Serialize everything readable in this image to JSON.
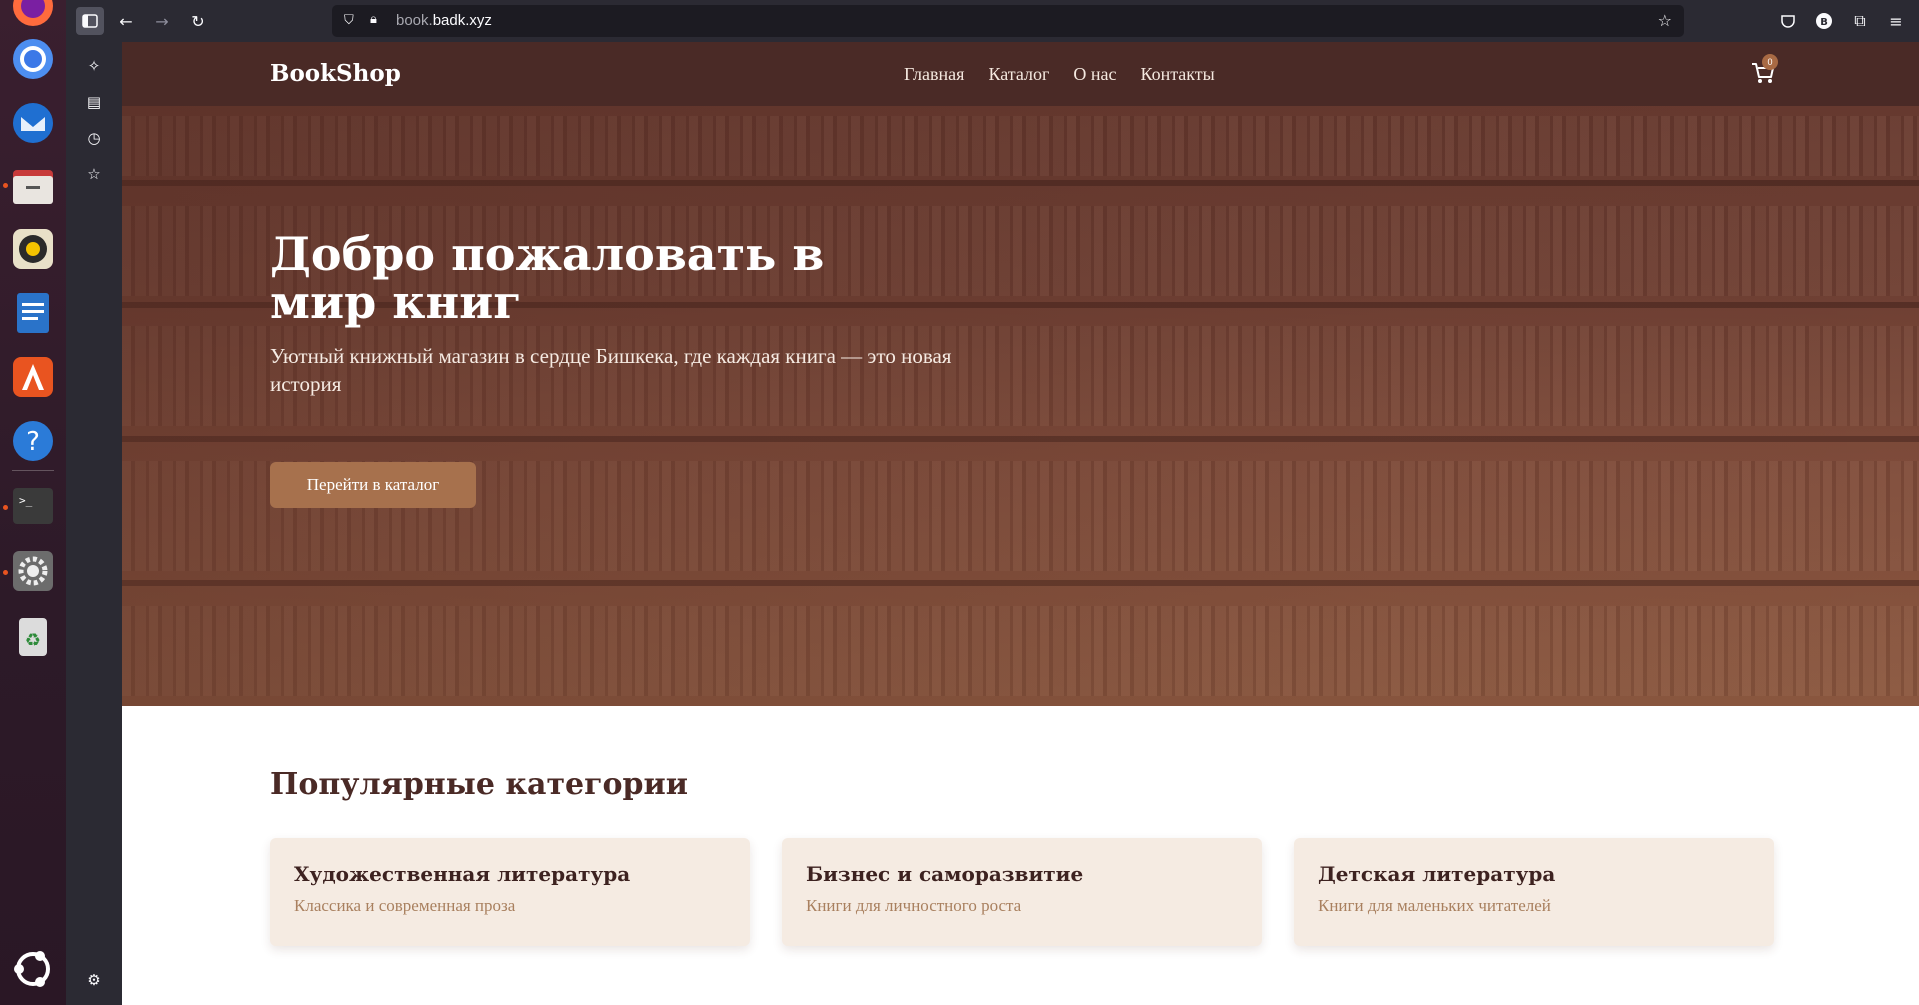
{
  "browser": {
    "url_prefix": "book.",
    "url_domain": "badk.xyz"
  },
  "site": {
    "logo": "BookShop",
    "nav": [
      "Главная",
      "Каталог",
      "О нас",
      "Контакты"
    ],
    "cart_count": "0"
  },
  "hero": {
    "title": "Добро пожаловать в мир книг",
    "subtitle": "Уютный книжный магазин в сердце Бишкека, где каждая книга — это новая история",
    "button": "Перейти в каталог"
  },
  "categories": {
    "title": "Популярные категории",
    "items": [
      {
        "title": "Художественная литература",
        "desc": "Классика и современная проза"
      },
      {
        "title": "Бизнес и саморазвитие",
        "desc": "Книги для личностного роста"
      },
      {
        "title": "Детская литература",
        "desc": "Книги для маленьких читателей"
      }
    ]
  },
  "colors": {
    "navbar": "#4a2a26",
    "accent": "#a7714d",
    "card_bg": "#f5ebe2"
  }
}
